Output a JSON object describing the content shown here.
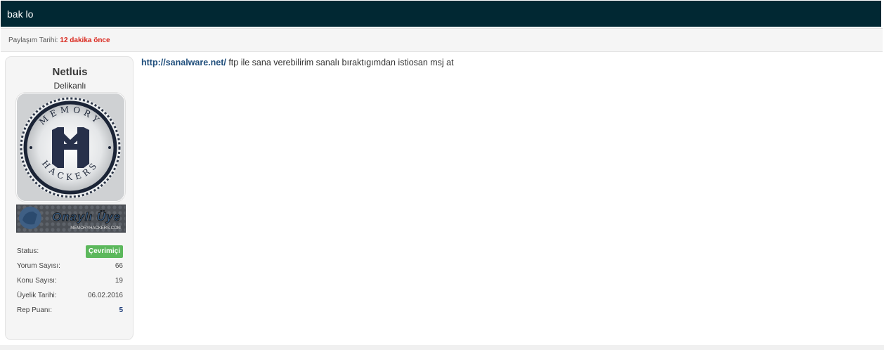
{
  "post": {
    "title": "bak lo",
    "date_label": "Paylaşım Tarihi:",
    "date_value": "12 dakika önce",
    "body": {
      "link_text": "http://sanalware.net/",
      "text": " ftp ile sana verebilirim sanalı bıraktıgımdan istiosan msj at"
    }
  },
  "author": {
    "name": "Netluis",
    "rank": "Delikanlı",
    "avatar": {
      "icon": "memory-hackers-logo",
      "top_text": "MEMORY",
      "bottom_text": "HACKERS"
    },
    "badge": {
      "icon": "verified-member-badge",
      "title": "Onaylı Üye",
      "subtitle": "MEMORYHACKERS.COM"
    },
    "stats": [
      {
        "label": "Status:",
        "value": "Çevrimiçi"
      },
      {
        "label": "Yorum Sayısı:",
        "value": "66"
      },
      {
        "label": "Konu Sayısı:",
        "value": "19"
      },
      {
        "label": "Üyelik Tarihi:",
        "value": "06.02.2016"
      },
      {
        "label": "Rep Puanı:",
        "value": "5"
      }
    ]
  },
  "colors": {
    "header_bg": "#012833",
    "date_accent": "#d9261c",
    "online": "#5cb85c",
    "link": "#1e4d7b"
  }
}
